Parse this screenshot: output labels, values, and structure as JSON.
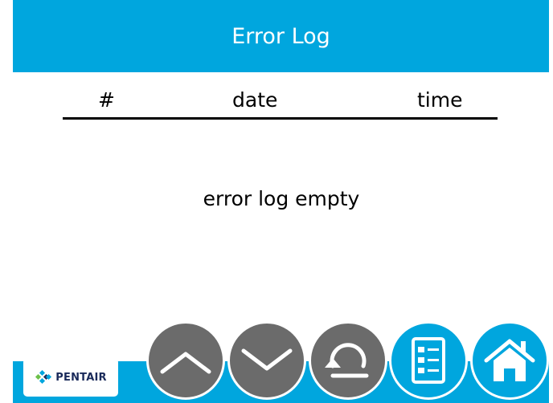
{
  "header": {
    "title": "Error Log"
  },
  "columns": {
    "number": "#",
    "date": "date",
    "time": "time"
  },
  "content": {
    "empty_message": "error log empty"
  },
  "footer": {
    "logo_text": "PENTAIR",
    "buttons": [
      {
        "name": "scroll-up",
        "icon": "chevron-up-icon"
      },
      {
        "name": "scroll-down",
        "icon": "chevron-down-icon"
      },
      {
        "name": "back",
        "icon": "back-arrow-icon"
      },
      {
        "name": "log",
        "icon": "checklist-icon"
      },
      {
        "name": "home",
        "icon": "home-icon"
      }
    ]
  },
  "colors": {
    "accent": "#00a6de",
    "button_gray": "#6b6b6b",
    "brand_navy": "#1a2a5a"
  }
}
